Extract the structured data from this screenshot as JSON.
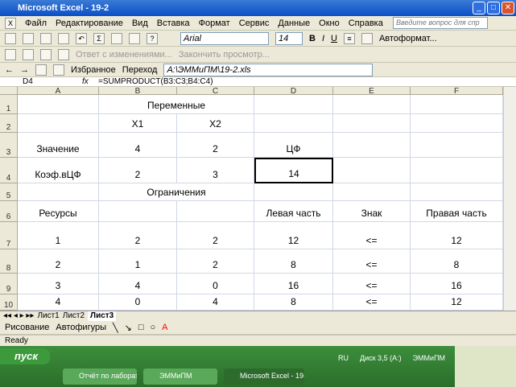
{
  "window": {
    "title": "Microsoft Excel - 19-2"
  },
  "menu": [
    "Файл",
    "Редактирование",
    "Вид",
    "Вставка",
    "Формат",
    "Сервис",
    "Данные",
    "Окно",
    "Справка"
  ],
  "help_placeholder": "Введите вопрос для спр",
  "toolbar": {
    "font": "Arial",
    "size": "14",
    "autoformat": "Автоформат..."
  },
  "toolbar2": {
    "reply": "Ответ с изменениями...",
    "end_review": "Закончить просмотр..."
  },
  "web": {
    "favorites": "Избранное",
    "go": "Переход",
    "address": "A:\\ЭММиПМ\\19-2.xls"
  },
  "formula": {
    "namebox": "D4",
    "fx": "fx",
    "value": "=SUMPRODUCT(B3:C3;B4:C4)"
  },
  "columns": [
    "A",
    "B",
    "C",
    "D",
    "E",
    "F"
  ],
  "rows": [
    {
      "n": "1",
      "cells": [
        "",
        "Переменные",
        "",
        "",
        "",
        ""
      ]
    },
    {
      "n": "2",
      "cells": [
        "",
        "X1",
        "X2",
        "",
        "",
        ""
      ]
    },
    {
      "n": "3",
      "cells": [
        "Значение",
        "4",
        "2",
        "ЦФ",
        "",
        ""
      ]
    },
    {
      "n": "4",
      "cells": [
        "Коэф.вЦФ",
        "2",
        "3",
        "14",
        "",
        ""
      ]
    },
    {
      "n": "5",
      "cells": [
        "",
        "Ограничения",
        "",
        "",
        "",
        ""
      ]
    },
    {
      "n": "6",
      "cells": [
        "Ресурсы",
        "",
        "",
        "Левая часть",
        "Знак",
        "Правая часть"
      ]
    },
    {
      "n": "7",
      "cells": [
        "1",
        "2",
        "2",
        "12",
        "<=",
        "12"
      ]
    },
    {
      "n": "8",
      "cells": [
        "2",
        "1",
        "2",
        "8",
        "<=",
        "8"
      ]
    },
    {
      "n": "9",
      "cells": [
        "3",
        "4",
        "0",
        "16",
        "<=",
        "16"
      ]
    },
    {
      "n": "10",
      "cells": [
        "4",
        "0",
        "4",
        "8",
        "<=",
        "12"
      ]
    }
  ],
  "sheets": [
    "Лист1",
    "Лист2",
    "Лист3"
  ],
  "draw": {
    "drawing": "Рисование",
    "autoshapes": "Автофигуры"
  },
  "status": "Ready",
  "taskbar": {
    "start": "пуск",
    "lang": "RU",
    "disk": "Диск 3,5 (A:)",
    "folder": "ЭММиПМ",
    "tasks": [
      "Отчёт по лаборато...",
      "ЭММиПМ",
      "Microsoft Excel - 19-2"
    ]
  }
}
